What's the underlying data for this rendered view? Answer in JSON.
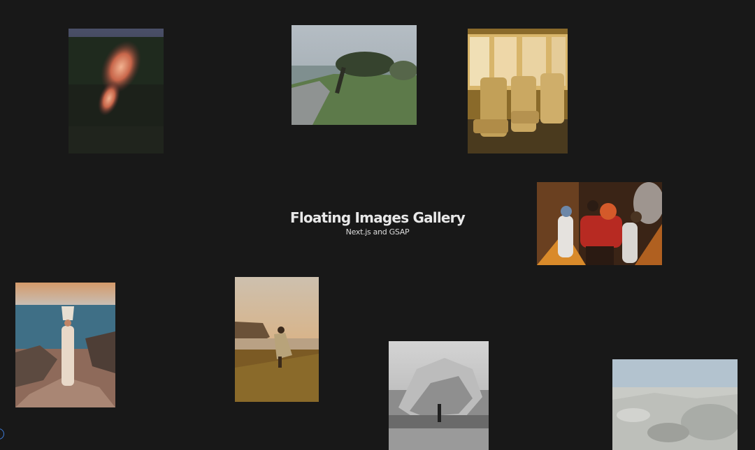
{
  "header": {
    "title": "Floating Images Gallery",
    "subtitle": "Next.js and GSAP"
  },
  "gallery": {
    "images": [
      {
        "name": "fire-field-photo"
      },
      {
        "name": "windswept-tree-photo"
      },
      {
        "name": "train-seats-photo"
      },
      {
        "name": "dancing-people-photo"
      },
      {
        "name": "woman-seaside-photo"
      },
      {
        "name": "cloaked-figure-photo"
      },
      {
        "name": "rock-formation-photo"
      },
      {
        "name": "white-landscape-photo"
      }
    ]
  },
  "colors": {
    "background": "#181818",
    "text": "#e8e8e8",
    "indicator": "#3d7bd8"
  }
}
